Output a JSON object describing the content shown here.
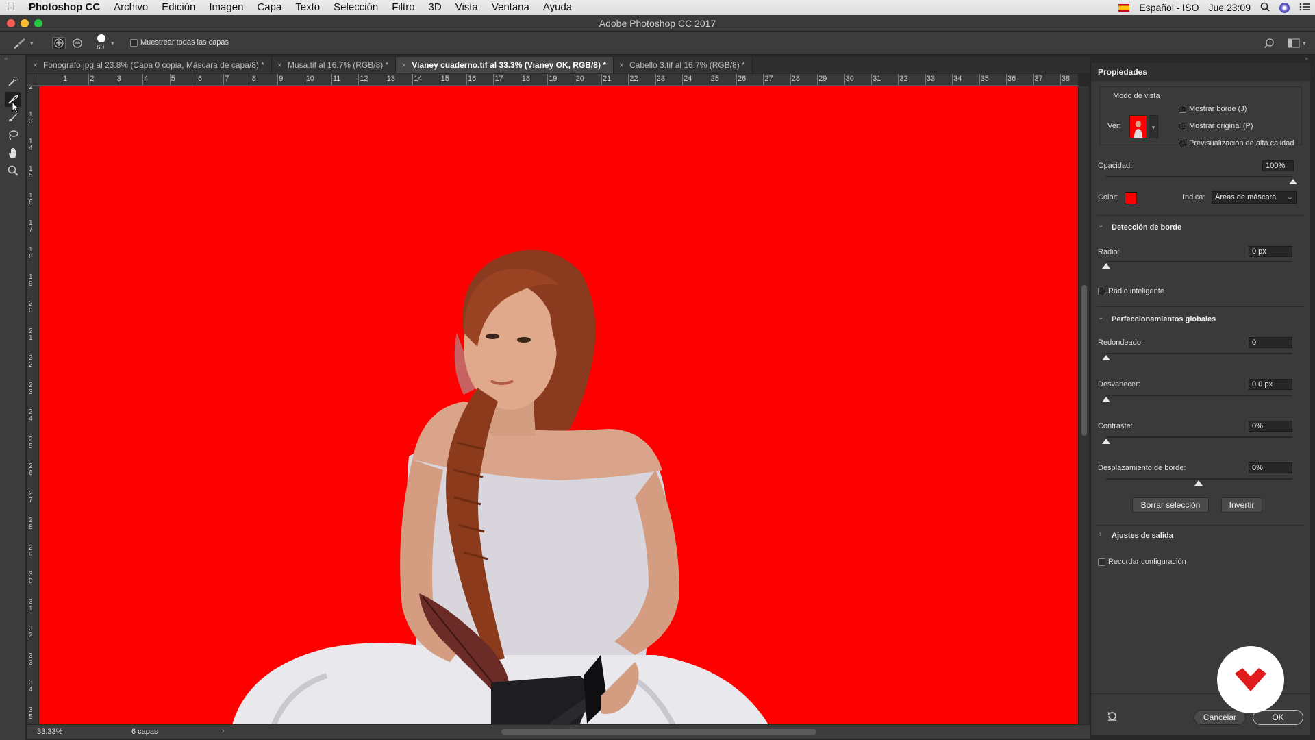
{
  "menubar": {
    "app": "Photoshop CC",
    "items": [
      "Archivo",
      "Edición",
      "Imagen",
      "Capa",
      "Texto",
      "Selección",
      "Filtro",
      "3D",
      "Vista",
      "Ventana",
      "Ayuda"
    ],
    "input_source": "Español - ISO",
    "clock": "Jue 23:09"
  },
  "window": {
    "title": "Adobe Photoshop CC 2017"
  },
  "options": {
    "brush_size": "60",
    "sample_all_layers": "Muestrear todas las capas"
  },
  "tabs": [
    {
      "label": "Fonografo.jpg al 23.8% (Capa 0 copia, Máscara de capa/8) *",
      "active": false
    },
    {
      "label": "Musa.tif al 16.7% (RGB/8) *",
      "active": false
    },
    {
      "label": "Vianey cuaderno.tif al 33.3% (Vianey OK, RGB/8) *",
      "active": true
    },
    {
      "label": "Cabello 3.tif al 16.7% (RGB/8) *",
      "active": false
    }
  ],
  "ruler": {
    "h": [
      "1",
      "2",
      "3",
      "4",
      "5",
      "6",
      "7",
      "8",
      "9",
      "10",
      "11",
      "12",
      "13",
      "14",
      "15",
      "16",
      "17",
      "18",
      "19",
      "20",
      "21",
      "22",
      "23",
      "24",
      "25",
      "26",
      "27",
      "28",
      "29",
      "30",
      "31",
      "32",
      "33",
      "34",
      "35",
      "36",
      "37",
      "38"
    ],
    "v": [
      "2",
      "1 3",
      "1 4",
      "1 5",
      "1 6",
      "1 7",
      "1 8",
      "1 9",
      "2 0",
      "2 1",
      "2 2",
      "2 3",
      "2 4",
      "2 5",
      "2 6",
      "2 7",
      "2 8",
      "2 9",
      "3 0",
      "3 1",
      "3 2",
      "3 3",
      "3 4",
      "3 5"
    ]
  },
  "status": {
    "zoom": "33.33%",
    "layers": "6 capas"
  },
  "panel": {
    "title": "Propiedades",
    "view_mode": "Modo de vista",
    "ver_label": "Ver:",
    "show_edge": "Mostrar borde (J)",
    "show_original": "Mostrar original (P)",
    "hq_preview": "Previsualización de alta calidad",
    "opacity_label": "Opacidad:",
    "opacity_value": "100%",
    "opacity_level": 1.0,
    "color_label": "Color:",
    "overlay_color": "#ff0000",
    "indicates_label": "Indica:",
    "indicates_value": "Áreas de máscara",
    "edge_section": "Detección de borde",
    "radius_label": "Radio:",
    "radius_value": "0 px",
    "smart_radius": "Radio inteligente",
    "global_section": "Perfeccionamientos globales",
    "smooth_label": "Redondeado:",
    "smooth_value": "0",
    "feather_label": "Desvanecer:",
    "feather_value": "0.0 px",
    "contrast_label": "Contraste:",
    "contrast_value": "0%",
    "shift_label": "Desplazamiento de borde:",
    "shift_value": "0%",
    "clear_btn": "Borrar selección",
    "invert_btn": "Invertir",
    "output_section": "Ajustes de salida",
    "remember": "Recordar configuración",
    "cancel_btn": "Cancelar",
    "ok_btn": "OK"
  }
}
